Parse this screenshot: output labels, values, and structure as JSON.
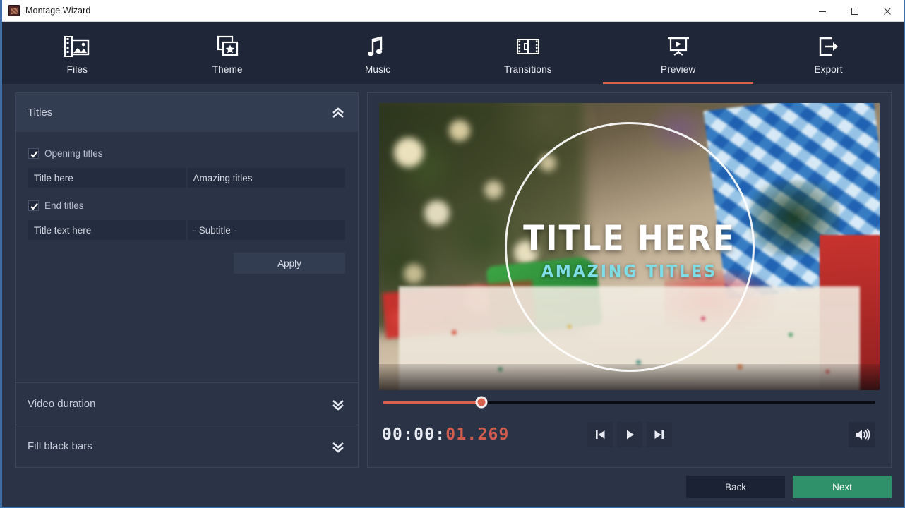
{
  "window": {
    "title": "Montage Wizard",
    "app_icon": "app-icon",
    "minimize": "minimize-icon",
    "maximize": "maximize-icon",
    "close": "close-icon"
  },
  "nav": {
    "items": [
      {
        "label": "Files",
        "icon": "files-icon",
        "active": false
      },
      {
        "label": "Theme",
        "icon": "theme-icon",
        "active": false
      },
      {
        "label": "Music",
        "icon": "music-icon",
        "active": false
      },
      {
        "label": "Transitions",
        "icon": "transitions-icon",
        "active": false
      },
      {
        "label": "Preview",
        "icon": "preview-icon",
        "active": true
      },
      {
        "label": "Export",
        "icon": "export-icon",
        "active": false
      }
    ],
    "active_index": 4,
    "active_underline_color": "#d9624f"
  },
  "sidebar": {
    "titles_section": {
      "header": "Titles",
      "collapse_icon": "chevron-up-double-icon",
      "opening_titles": {
        "label": "Opening titles",
        "checked": true,
        "title_value": "Title here",
        "subtitle_value": "Amazing titles"
      },
      "end_titles": {
        "label": "End titles",
        "checked": true,
        "title_value": "Title text here",
        "subtitle_value": "- Subtitle -"
      },
      "apply_label": "Apply"
    },
    "video_duration_section": {
      "header": "Video duration",
      "expand_icon": "chevron-down-double-icon"
    },
    "fill_black_bars_section": {
      "header": "Fill black bars",
      "expand_icon": "chevron-down-double-icon"
    }
  },
  "preview": {
    "overlay_title": "TITLE HERE",
    "overlay_subtitle": "AMAZING TITLES",
    "overlay_title_color": "#ffffff",
    "overlay_subtitle_color": "#7fdde6",
    "seek": {
      "progress_percent": 20,
      "fill_color": "#d9624f",
      "track_color": "#0a0c13"
    },
    "timecode": {
      "elapsed_prefix": "00:00:",
      "elapsed_highlight": "01.269",
      "prefix_color": "#e8ebf1",
      "highlight_color": "#cf5d4e"
    },
    "transport": {
      "previous": "skip-previous-icon",
      "play": "play-icon",
      "next": "skip-next-icon",
      "volume": "volume-icon"
    }
  },
  "footer": {
    "back_label": "Back",
    "next_label": "Next",
    "next_color": "#2e9169"
  }
}
